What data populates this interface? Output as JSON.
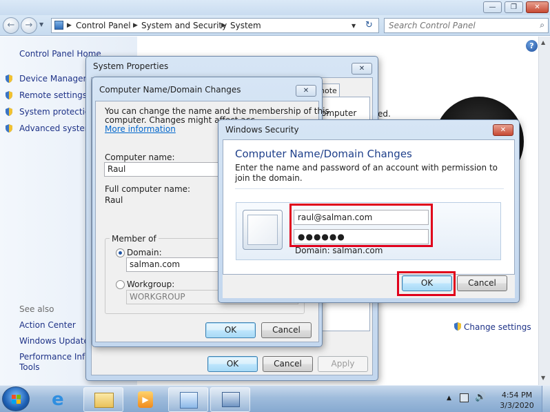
{
  "explorer": {
    "breadcrumbs": [
      "Control Panel",
      "System and Security",
      "System"
    ],
    "search_placeholder": "Search Control Panel"
  },
  "leftpane": {
    "home": "Control Panel Home",
    "tasks": [
      "Device Manager",
      "Remote settings",
      "System protection",
      "Advanced system"
    ],
    "see_also_title": "See also",
    "see_also": [
      "Action Center",
      "Windows Update",
      "Performance Infor",
      "Tools"
    ]
  },
  "main": {
    "change_settings": "Change settings",
    "partial_text": "ed."
  },
  "system_properties": {
    "title": "System Properties",
    "tab_fragment": "note",
    "side_text": "omputer",
    "ok": "OK",
    "cancel": "Cancel",
    "apply": "Apply"
  },
  "cn_dialog": {
    "title": "Computer Name/Domain Changes",
    "intro_line1": "You can change the name and the membership of this",
    "intro_line2": "computer. Changes might affect acc",
    "more_info": "More information",
    "computer_name_label": "Computer name:",
    "computer_name_value": "Raul",
    "full_name_label": "Full computer name:",
    "full_name_value": "Raul",
    "member_of": "Member of",
    "domain_label": "Domain:",
    "domain_value": "salman.com",
    "workgroup_label": "Workgroup:",
    "workgroup_value": "WORKGROUP",
    "ok": "OK",
    "cancel": "Cancel"
  },
  "security": {
    "title": "Windows Security",
    "heading": "Computer Name/Domain Changes",
    "text": "Enter the name and password of an account with permission to join the domain.",
    "username": "raul@salman.com",
    "password": "●●●●●●",
    "domain_note": "Domain: salman.com",
    "ok": "OK",
    "cancel": "Cancel"
  },
  "taskbar": {
    "time": "4:54 PM",
    "date": "3/3/2020"
  },
  "colors": {
    "highlight": "#e0001a",
    "link": "#1e3287"
  }
}
